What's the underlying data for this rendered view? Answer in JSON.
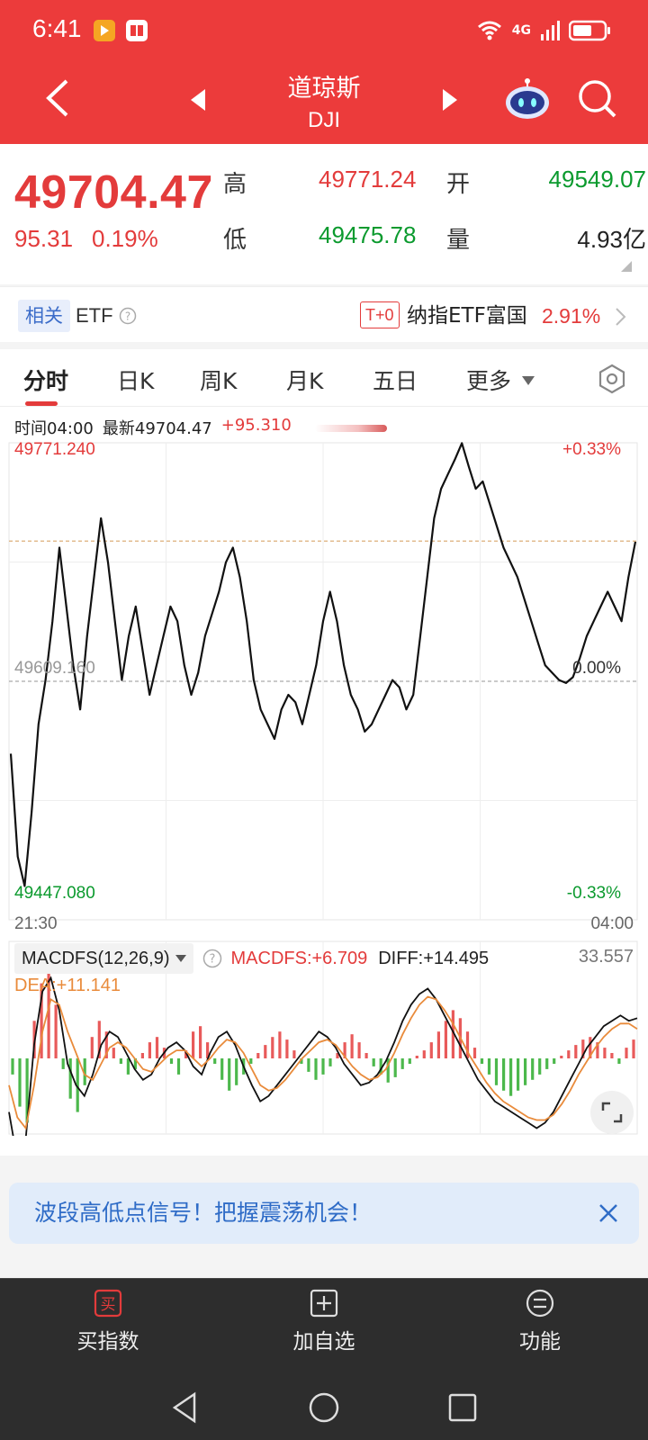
{
  "status_bar": {
    "time": "6:41",
    "network": "4G"
  },
  "nav": {
    "title": "道琼斯",
    "subtitle": "DJI"
  },
  "quote": {
    "price": "49704.47",
    "change": "95.31",
    "change_pct": "0.19%",
    "high_label": "高",
    "high_value": "49771.24",
    "low_label": "低",
    "low_value": "49475.78",
    "open_label": "开",
    "open_value": "49549.07",
    "volume_label": "量",
    "volume_value": "4.93亿"
  },
  "etf": {
    "tag": "相关",
    "label": "ETF",
    "badge": "T+0",
    "name": "纳指ETF富国",
    "pct": "2.91%"
  },
  "tabs": [
    "分时",
    "日K",
    "周K",
    "月K",
    "五日",
    "更多"
  ],
  "chart_info": {
    "time_label": "时间04:00",
    "latest_label": "最新49704.47",
    "change": "+95.310"
  },
  "chart_data": [
    {
      "type": "line",
      "x_start": "21:30",
      "x_end": "04:00",
      "y_max_label": "49771.240",
      "y_min_label": "49447.080",
      "y_mid_label": "49609.160",
      "pct_max_label": "+0.33%",
      "pct_mid_label": "0.00%",
      "pct_min_label": "-0.33%",
      "ylim": [
        49447.08,
        49771.24
      ],
      "reference_close": 49609.16,
      "open_value": 49549.07,
      "last_value": 49704.47,
      "series": [
        {
          "values": [
            49560,
            49490,
            49470,
            49520,
            49580,
            49610,
            49650,
            49700,
            49660,
            49620,
            49590,
            49640,
            49680,
            49720,
            49690,
            49650,
            49610,
            49640,
            49660,
            49630,
            49600,
            49620,
            49640,
            49660,
            49650,
            49620,
            49600,
            49615,
            49640,
            49655,
            49670,
            49690,
            49700,
            49680,
            49650,
            49610,
            49590,
            49580,
            49570,
            49590,
            49600,
            49595,
            49580,
            49600,
            49620,
            49650,
            49670,
            49650,
            49620,
            49600,
            49590,
            49575,
            49580,
            49590,
            49600,
            49610,
            49605,
            49590,
            49600,
            49640,
            49680,
            49720,
            49740,
            49750,
            49760,
            49771,
            49755,
            49740,
            49745,
            49730,
            49715,
            49700,
            49690,
            49680,
            49665,
            49650,
            49635,
            49620,
            49615,
            49610,
            49608,
            49612,
            49625,
            49640,
            49650,
            49660,
            49670,
            49660,
            49650,
            49680,
            49704
          ]
        }
      ]
    },
    {
      "type": "bar",
      "title": "MACDFS(12,26,9)",
      "macd_value": "MACDFS:+6.709",
      "diff_value": "DIFF:+14.495",
      "dea_value": "DEA:+11.141",
      "max_label": "33.557",
      "series": [
        {
          "name": "MACDFS",
          "values": [
            -6,
            -18,
            -24,
            14,
            28,
            33,
            20,
            -4,
            -15,
            -20,
            -10,
            8,
            14,
            10,
            4,
            -2,
            -6,
            -4,
            2,
            6,
            8,
            4,
            -2,
            -6,
            3,
            10,
            12,
            6,
            -2,
            -8,
            -12,
            -10,
            -6,
            -2,
            2,
            5,
            8,
            10,
            7,
            3,
            -2,
            -5,
            -8,
            -6,
            -3,
            2,
            6,
            9,
            6,
            2,
            -3,
            -6,
            -9,
            -7,
            -4,
            -2,
            1,
            3,
            6,
            10,
            14,
            18,
            15,
            10,
            4,
            -2,
            -6,
            -10,
            -12,
            -14,
            -12,
            -10,
            -8,
            -6,
            -4,
            -2,
            1,
            3,
            5,
            7,
            8,
            6,
            4,
            2,
            -2,
            4,
            7
          ]
        },
        {
          "name": "DIFF",
          "values": [
            -20,
            -38,
            -30,
            5,
            25,
            30,
            18,
            -2,
            -10,
            -14,
            -6,
            5,
            10,
            8,
            2,
            -4,
            -8,
            -6,
            0,
            4,
            6,
            3,
            -3,
            -6,
            2,
            8,
            10,
            5,
            -3,
            -10,
            -16,
            -14,
            -10,
            -6,
            -2,
            2,
            6,
            10,
            8,
            4,
            -2,
            -6,
            -10,
            -9,
            -6,
            -1,
            6,
            14,
            20,
            24,
            26,
            22,
            16,
            10,
            4,
            -2,
            -8,
            -12,
            -16,
            -18,
            -20,
            -22,
            -24,
            -26,
            -24,
            -20,
            -14,
            -8,
            -2,
            4,
            8,
            12,
            14,
            16,
            14,
            15
          ]
        },
        {
          "name": "DEA",
          "values": [
            -10,
            -22,
            -26,
            -10,
            10,
            22,
            20,
            10,
            2,
            -6,
            -8,
            -2,
            4,
            6,
            4,
            0,
            -4,
            -5,
            -2,
            1,
            3,
            3,
            0,
            -3,
            0,
            4,
            7,
            6,
            2,
            -4,
            -10,
            -12,
            -11,
            -8,
            -4,
            0,
            3,
            6,
            7,
            5,
            1,
            -3,
            -6,
            -8,
            -7,
            -4,
            2,
            9,
            15,
            20,
            23,
            22,
            18,
            13,
            7,
            1,
            -4,
            -9,
            -13,
            -16,
            -18,
            -20,
            -22,
            -23,
            -23,
            -21,
            -17,
            -12,
            -6,
            -1,
            4,
            8,
            11,
            13,
            13,
            11
          ]
        }
      ]
    }
  ],
  "banner": {
    "text": "波段高低点信号！把握震荡机会！"
  },
  "toolbar": {
    "buy_icon_text": "买",
    "buy": "买指数",
    "watch": "加自选",
    "func": "功能"
  },
  "colors": {
    "header_red": "#ec3b3b",
    "up_red": "#e33b3b",
    "down_green": "#0b9a2e",
    "dea_orange": "#e98b3b",
    "banner_blue": "#2f6cc7"
  }
}
